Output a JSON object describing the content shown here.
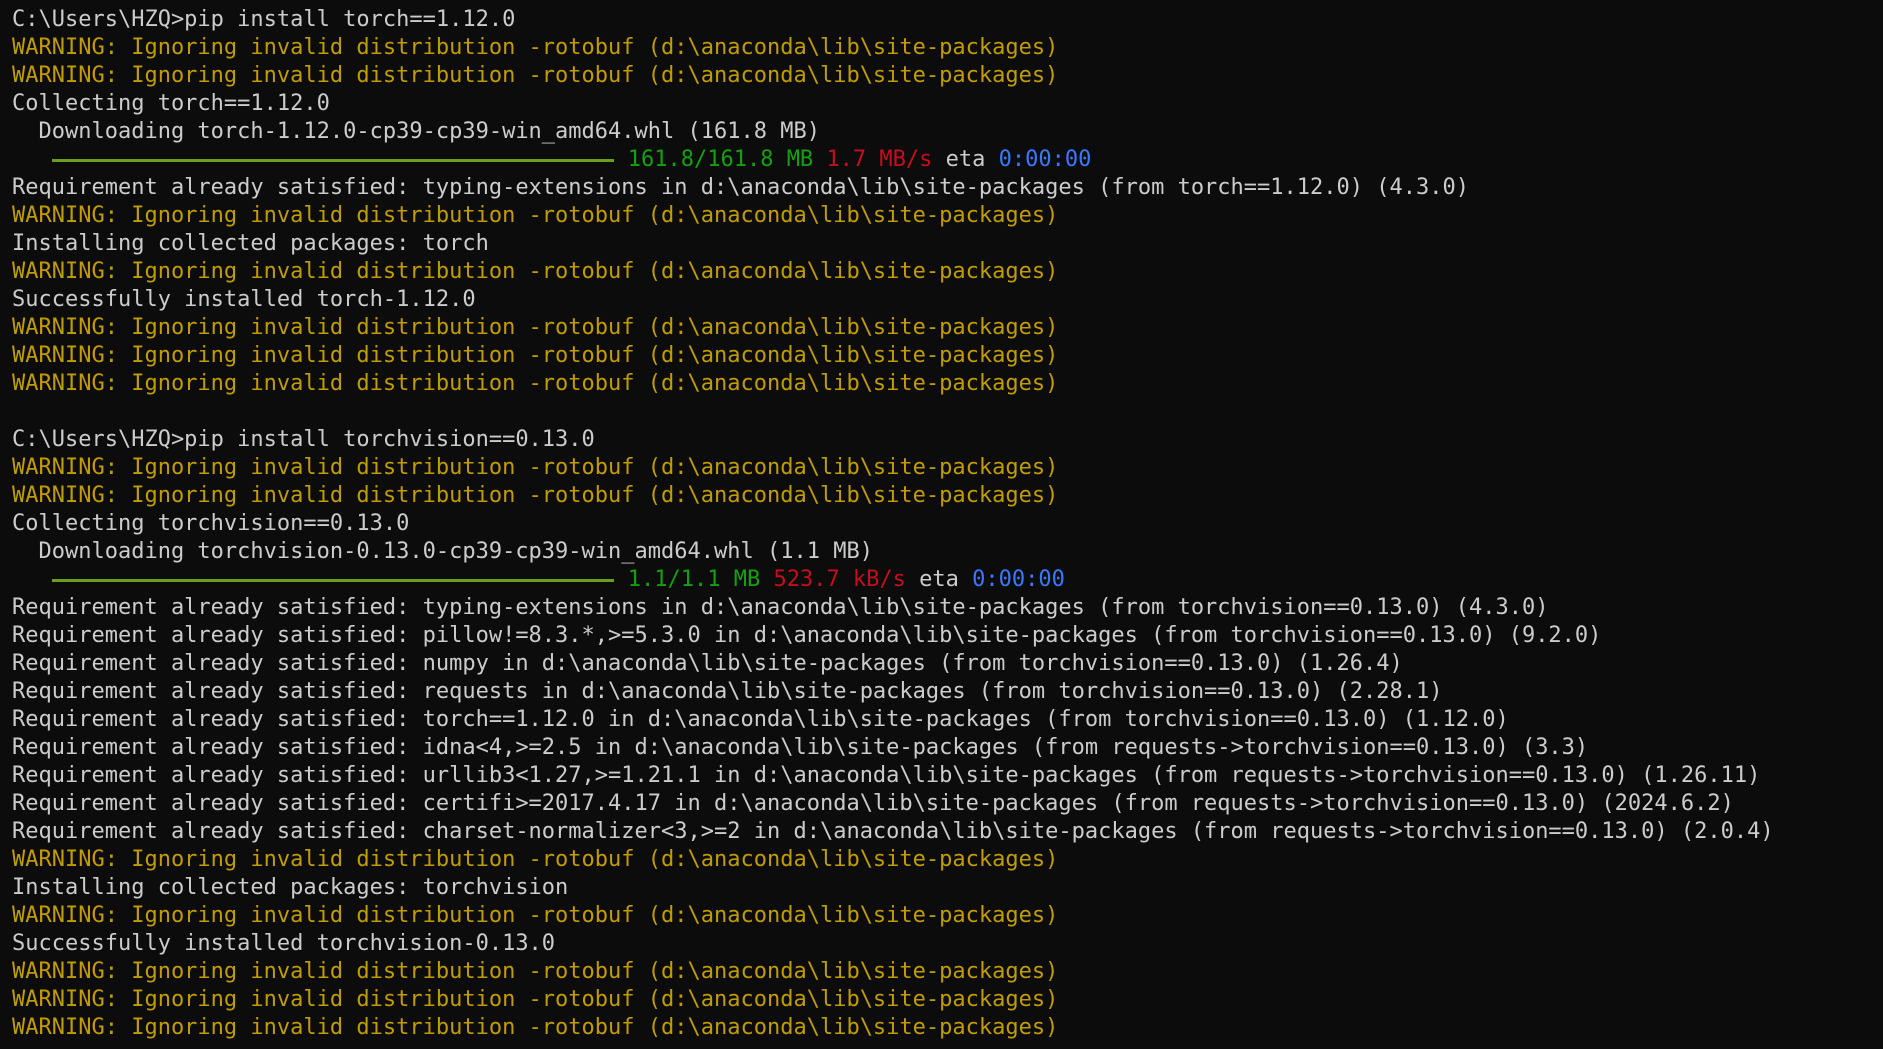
{
  "terminal": {
    "colors": {
      "background": "#0c0c0c",
      "text": "#cccccc",
      "warning": "#c19c00",
      "progress_done": "#13a10e",
      "speed": "#c50f1f",
      "eta": "#3b78ff",
      "progress_bar": "#6a9f1d"
    },
    "lines": [
      {
        "segments": [
          {
            "text": "C:\\Users\\HZQ>pip install torch==1.12.0",
            "color": "default"
          }
        ]
      },
      {
        "segments": [
          {
            "text": "WARNING: Ignoring invalid distribution -rotobuf (d:\\anaconda\\lib\\site-packages)",
            "color": "warn"
          }
        ]
      },
      {
        "segments": [
          {
            "text": "WARNING: Ignoring invalid distribution -rotobuf (d:\\anaconda\\lib\\site-packages)",
            "color": "warn"
          }
        ]
      },
      {
        "segments": [
          {
            "text": "Collecting torch==1.12.0",
            "color": "default"
          }
        ]
      },
      {
        "segments": [
          {
            "text": "  Downloading torch-1.12.0-cp39-cp39-win_amd64.whl (161.8 MB)",
            "color": "default"
          }
        ]
      },
      {
        "progress": 1.0,
        "segments": [
          {
            "text": "161.8/161.8 MB",
            "color": "green"
          },
          {
            "text": " ",
            "color": "default"
          },
          {
            "text": "1.7 MB/s",
            "color": "red"
          },
          {
            "text": " eta ",
            "color": "default"
          },
          {
            "text": "0:00:00",
            "color": "blue"
          }
        ]
      },
      {
        "segments": [
          {
            "text": "Requirement already satisfied: typing-extensions in d:\\anaconda\\lib\\site-packages (from torch==1.12.0) (4.3.0)",
            "color": "default"
          }
        ]
      },
      {
        "segments": [
          {
            "text": "WARNING: Ignoring invalid distribution -rotobuf (d:\\anaconda\\lib\\site-packages)",
            "color": "warn"
          }
        ]
      },
      {
        "segments": [
          {
            "text": "Installing collected packages: torch",
            "color": "default"
          }
        ]
      },
      {
        "segments": [
          {
            "text": "WARNING: Ignoring invalid distribution -rotobuf (d:\\anaconda\\lib\\site-packages)",
            "color": "warn"
          }
        ]
      },
      {
        "segments": [
          {
            "text": "Successfully installed torch-1.12.0",
            "color": "default"
          }
        ]
      },
      {
        "segments": [
          {
            "text": "WARNING: Ignoring invalid distribution -rotobuf (d:\\anaconda\\lib\\site-packages)",
            "color": "warn"
          }
        ]
      },
      {
        "segments": [
          {
            "text": "WARNING: Ignoring invalid distribution -rotobuf (d:\\anaconda\\lib\\site-packages)",
            "color": "warn"
          }
        ]
      },
      {
        "segments": [
          {
            "text": "WARNING: Ignoring invalid distribution -rotobuf (d:\\anaconda\\lib\\site-packages)",
            "color": "warn"
          }
        ]
      },
      {
        "segments": [
          {
            "text": "",
            "color": "default"
          }
        ]
      },
      {
        "segments": [
          {
            "text": "C:\\Users\\HZQ>pip install torchvision==0.13.0",
            "color": "default"
          }
        ]
      },
      {
        "segments": [
          {
            "text": "WARNING: Ignoring invalid distribution -rotobuf (d:\\anaconda\\lib\\site-packages)",
            "color": "warn"
          }
        ]
      },
      {
        "segments": [
          {
            "text": "WARNING: Ignoring invalid distribution -rotobuf (d:\\anaconda\\lib\\site-packages)",
            "color": "warn"
          }
        ]
      },
      {
        "segments": [
          {
            "text": "Collecting torchvision==0.13.0",
            "color": "default"
          }
        ]
      },
      {
        "segments": [
          {
            "text": "  Downloading torchvision-0.13.0-cp39-cp39-win_amd64.whl (1.1 MB)",
            "color": "default"
          }
        ]
      },
      {
        "progress": 1.0,
        "segments": [
          {
            "text": "1.1/1.1 MB",
            "color": "green"
          },
          {
            "text": " ",
            "color": "default"
          },
          {
            "text": "523.7 kB/s",
            "color": "red"
          },
          {
            "text": " eta ",
            "color": "default"
          },
          {
            "text": "0:00:00",
            "color": "blue"
          }
        ]
      },
      {
        "segments": [
          {
            "text": "Requirement already satisfied: typing-extensions in d:\\anaconda\\lib\\site-packages (from torchvision==0.13.0) (4.3.0)",
            "color": "default"
          }
        ]
      },
      {
        "segments": [
          {
            "text": "Requirement already satisfied: pillow!=8.3.*,>=5.3.0 in d:\\anaconda\\lib\\site-packages (from torchvision==0.13.0) (9.2.0)",
            "color": "default"
          }
        ]
      },
      {
        "segments": [
          {
            "text": "Requirement already satisfied: numpy in d:\\anaconda\\lib\\site-packages (from torchvision==0.13.0) (1.26.4)",
            "color": "default"
          }
        ]
      },
      {
        "segments": [
          {
            "text": "Requirement already satisfied: requests in d:\\anaconda\\lib\\site-packages (from torchvision==0.13.0) (2.28.1)",
            "color": "default"
          }
        ]
      },
      {
        "segments": [
          {
            "text": "Requirement already satisfied: torch==1.12.0 in d:\\anaconda\\lib\\site-packages (from torchvision==0.13.0) (1.12.0)",
            "color": "default"
          }
        ]
      },
      {
        "segments": [
          {
            "text": "Requirement already satisfied: idna<4,>=2.5 in d:\\anaconda\\lib\\site-packages (from requests->torchvision==0.13.0) (3.3)",
            "color": "default"
          }
        ]
      },
      {
        "segments": [
          {
            "text": "Requirement already satisfied: urllib3<1.27,>=1.21.1 in d:\\anaconda\\lib\\site-packages (from requests->torchvision==0.13.0) (1.26.11)",
            "color": "default"
          }
        ]
      },
      {
        "segments": [
          {
            "text": "Requirement already satisfied: certifi>=2017.4.17 in d:\\anaconda\\lib\\site-packages (from requests->torchvision==0.13.0) (2024.6.2)",
            "color": "default"
          }
        ]
      },
      {
        "segments": [
          {
            "text": "Requirement already satisfied: charset-normalizer<3,>=2 in d:\\anaconda\\lib\\site-packages (from requests->torchvision==0.13.0) (2.0.4)",
            "color": "default"
          }
        ]
      },
      {
        "segments": [
          {
            "text": "WARNING: Ignoring invalid distribution -rotobuf (d:\\anaconda\\lib\\site-packages)",
            "color": "warn"
          }
        ]
      },
      {
        "segments": [
          {
            "text": "Installing collected packages: torchvision",
            "color": "default"
          }
        ]
      },
      {
        "segments": [
          {
            "text": "WARNING: Ignoring invalid distribution -rotobuf (d:\\anaconda\\lib\\site-packages)",
            "color": "warn"
          }
        ]
      },
      {
        "segments": [
          {
            "text": "Successfully installed torchvision-0.13.0",
            "color": "default"
          }
        ]
      },
      {
        "segments": [
          {
            "text": "WARNING: Ignoring invalid distribution -rotobuf (d:\\anaconda\\lib\\site-packages)",
            "color": "warn"
          }
        ]
      },
      {
        "segments": [
          {
            "text": "WARNING: Ignoring invalid distribution -rotobuf (d:\\anaconda\\lib\\site-packages)",
            "color": "warn"
          }
        ]
      },
      {
        "segments": [
          {
            "text": "WARNING: Ignoring invalid distribution -rotobuf (d:\\anaconda\\lib\\site-packages)",
            "color": "warn"
          }
        ]
      }
    ]
  }
}
